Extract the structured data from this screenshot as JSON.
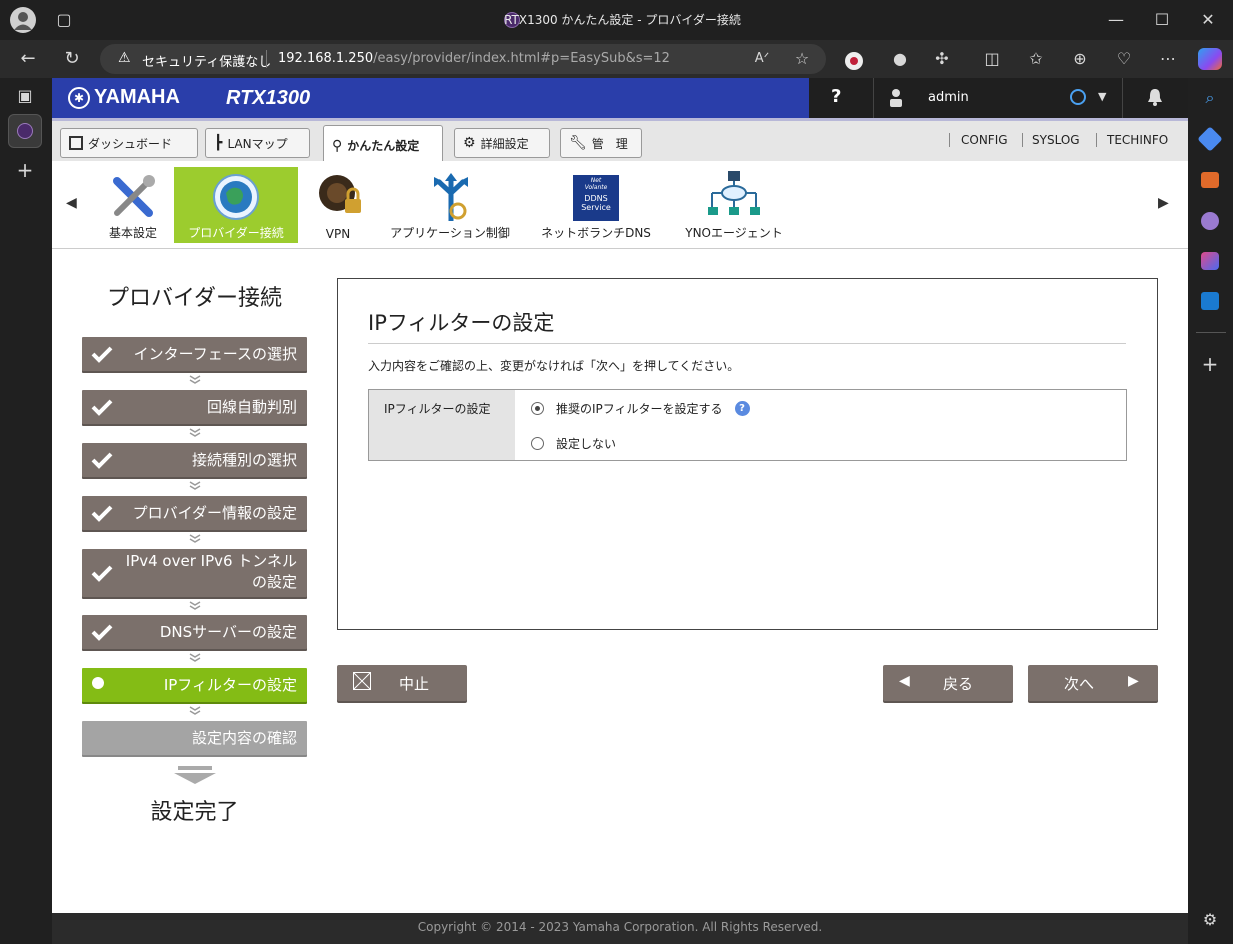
{
  "browser": {
    "window_title": "RTX1300 かんたん設定 - プロバイダー接続",
    "security_label": "セキュリティ保護なし",
    "url_host": "192.168.1.250",
    "url_path": "/easy/provider/index.html#p=EasySub&s=12",
    "window_controls": [
      "minimize-icon",
      "maximize-icon",
      "close-icon"
    ]
  },
  "header": {
    "brand": "YAMAHA",
    "model": "RTX1300",
    "help": "?",
    "user": "admin",
    "brand_color": "#2a3eaa"
  },
  "nav": {
    "tabs": [
      {
        "label": "ダッシュボード",
        "icon": "dashboard-icon"
      },
      {
        "label": "LANマップ",
        "icon": "lanmap-icon"
      },
      {
        "label": "かんたん設定",
        "icon": "wand-icon",
        "active": true
      },
      {
        "label": "詳細設定",
        "icon": "gear-icon"
      },
      {
        "label": "管　理",
        "icon": "wrench-icon"
      }
    ],
    "links": [
      "CONFIG",
      "SYSLOG",
      "TECHINFO"
    ]
  },
  "features": [
    {
      "label": "基本設定",
      "icon": "tools-icon"
    },
    {
      "label": "プロバイダー接続",
      "icon": "globe-icon",
      "selected": true
    },
    {
      "label": "VPN",
      "icon": "vpn-lock-icon"
    },
    {
      "label": "アプリケーション制御",
      "icon": "app-control-icon"
    },
    {
      "label": "ネットボランチDNS",
      "icon": "ddns-icon",
      "badge_line1": "Net",
      "badge_line2": "Volante",
      "badge_line3": "DDNS",
      "badge_line4": "Service"
    },
    {
      "label": "YNOエージェント",
      "icon": "network-icon"
    }
  ],
  "wizard": {
    "title": "プロバイダー接続",
    "steps": [
      {
        "label": "インターフェースの選択",
        "state": "done"
      },
      {
        "label": "回線自動判別",
        "state": "done"
      },
      {
        "label": "接続種別の選択",
        "state": "done"
      },
      {
        "label": "プロバイダー情報の設定",
        "state": "done"
      },
      {
        "label": "IPv4 over IPv6 トンネル",
        "label2": "の設定",
        "state": "done"
      },
      {
        "label": "DNSサーバーの設定",
        "state": "done"
      },
      {
        "label": "IPフィルターの設定",
        "state": "current"
      },
      {
        "label": "設定内容の確認",
        "state": "pending"
      }
    ],
    "finish": "設定完了"
  },
  "panel": {
    "title": "IPフィルターの設定",
    "instruction": "入力内容をご確認の上、変更がなければ「次へ」を押してください。",
    "row_label": "IPフィルターの設定",
    "options": [
      {
        "label": "推奨のIPフィルターを設定する",
        "checked": true
      },
      {
        "label": "設定しない",
        "checked": false
      }
    ]
  },
  "buttons": {
    "cancel": "中止",
    "back": "戻る",
    "next": "次へ"
  },
  "footer": "Copyright © 2014 - 2023 Yamaha Corporation. All Rights Reserved."
}
